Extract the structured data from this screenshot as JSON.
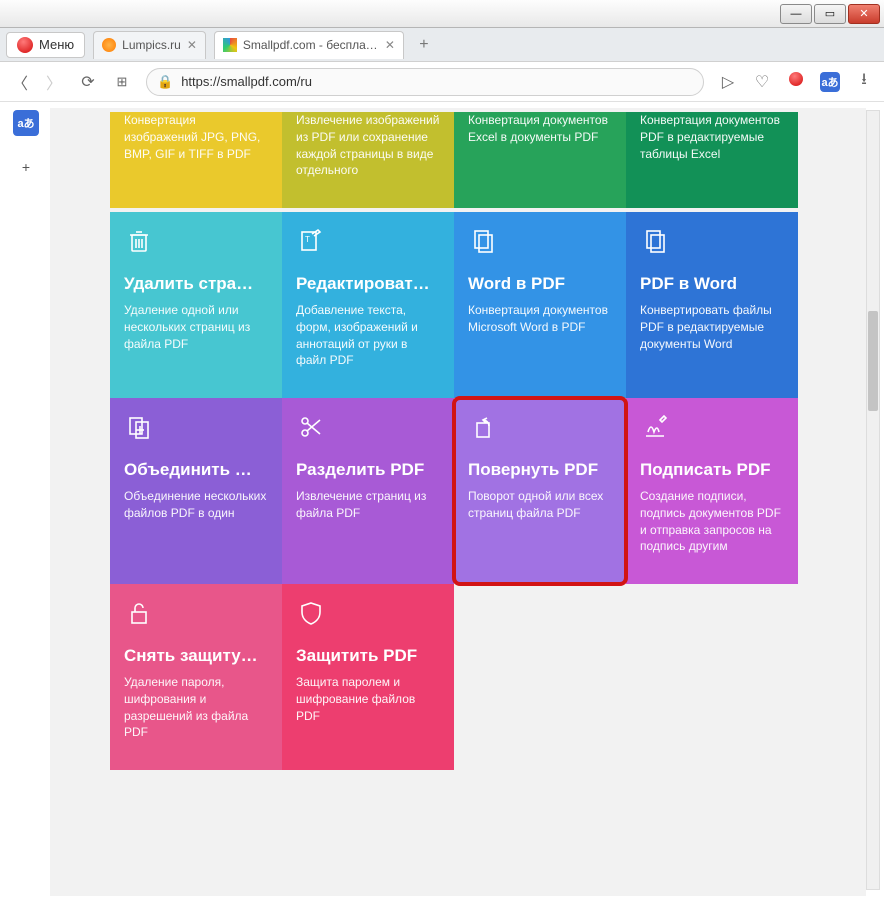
{
  "window": {
    "menu_label": "Меню",
    "tabs": [
      {
        "label": "Lumpics.ru",
        "active": false,
        "fav": "orange"
      },
      {
        "label": "Smallpdf.com - бесплатнс",
        "active": true,
        "fav": "multi"
      }
    ],
    "url": "https://smallpdf.com/ru",
    "url_display_prefix": "https://",
    "url_display_host": "smallpdf.com",
    "url_display_path": "/ru"
  },
  "tiles_partial": [
    {
      "color": "#eac92c",
      "desc": "Конвертация изображений JPG, PNG, BMP, GIF и TIFF в PDF"
    },
    {
      "color": "#c2bf2e",
      "desc": "Извлечение изображений из PDF или сохранение каждой страницы в виде отдельного"
    },
    {
      "color": "#27a35a",
      "desc": "Конвертация документов Excel в документы PDF"
    },
    {
      "color": "#129157",
      "desc": "Конвертация документов PDF в редактируемые таблицы Excel"
    }
  ],
  "tiles": [
    {
      "color": "#47c6d1",
      "title": "Удалить стра…",
      "desc": "Удаление одной или нескольких страниц из файла PDF",
      "icon": "trash"
    },
    {
      "color": "#33b1de",
      "title": "Редактироват…",
      "desc": "Добавление текста, форм, изображений и аннотаций от руки в файл PDF",
      "icon": "edit"
    },
    {
      "color": "#3393e6",
      "title": "Word в PDF",
      "desc": "Конвертация документов Microsoft Word в PDF",
      "icon": "doc"
    },
    {
      "color": "#2e74d6",
      "title": "PDF в Word",
      "desc": "Конвертировать файлы PDF в редактируемые документы Word",
      "icon": "copy"
    },
    {
      "color": "#8b5fd6",
      "title": "Объединить …",
      "desc": "Объединение нескольких файлов PDF в один",
      "icon": "merge"
    },
    {
      "color": "#a85ad6",
      "title": "Разделить PDF",
      "desc": "Извлечение страниц из файла PDF",
      "icon": "scissors"
    },
    {
      "color": "#a172e3",
      "title": "Повернуть PDF",
      "desc": "Поворот одной или всех страниц файла PDF",
      "icon": "rotate",
      "highlight": true
    },
    {
      "color": "#c858d6",
      "title": "Подписать PDF",
      "desc": "Создание подписи, подпись документов PDF и отправка запросов на подпись другим",
      "icon": "sign"
    },
    {
      "color": "#e8568a",
      "title": "Снять защиту…",
      "desc": "Удаление пароля, шифрования и разрешений из файла PDF",
      "icon": "unlock"
    },
    {
      "color": "#ed3e6f",
      "title": "Защитить PDF",
      "desc": "Защита паролем и шифрование файлов PDF",
      "icon": "shield"
    }
  ]
}
